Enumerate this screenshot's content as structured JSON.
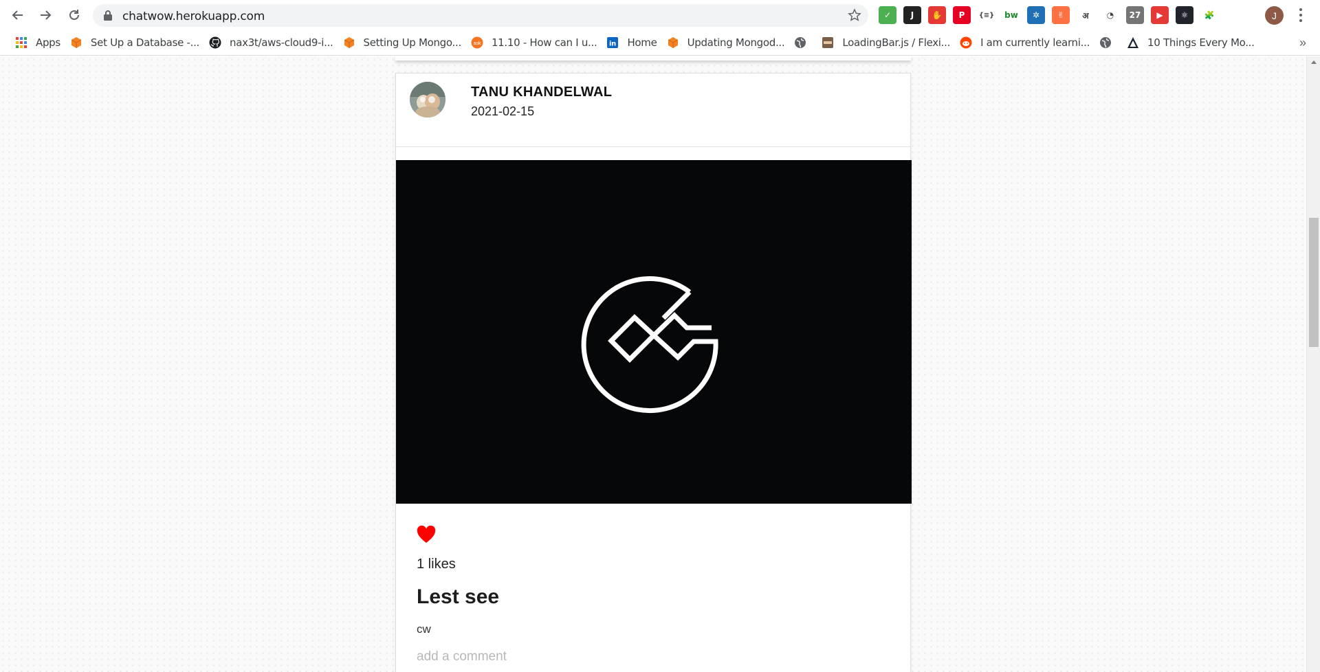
{
  "browser": {
    "url": "chatwow.herokuapp.com",
    "profile_initial": "J",
    "more_bookmarks": "»"
  },
  "bookmarks": [
    {
      "label": "Apps",
      "icon": "apps-grid-icon"
    },
    {
      "label": "Set Up a Database -...",
      "icon": "aws-cube-icon"
    },
    {
      "label": "nax3t/aws-cloud9-i...",
      "icon": "github-icon"
    },
    {
      "label": "Setting Up Mongo...",
      "icon": "aws-cube-icon"
    },
    {
      "label": "11.10 - How can I u...",
      "icon": "askubuntu-icon"
    },
    {
      "label": "Home",
      "icon": "linkedin-icon"
    },
    {
      "label": "Updating Mongod...",
      "icon": "aws-cube-icon"
    },
    {
      "label": "",
      "icon": "globe-icon"
    },
    {
      "label": "LoadingBar.js / Flexi...",
      "icon": "loadingbar-icon"
    },
    {
      "label": "I am currently learni...",
      "icon": "reddit-icon"
    },
    {
      "label": "",
      "icon": "globe-icon"
    },
    {
      "label": "10 Things Every Mo...",
      "icon": "triangle-logo-icon"
    }
  ],
  "extensions": [
    {
      "name": "mail-check-extension",
      "glyph": "✓",
      "color": "#4caf50"
    },
    {
      "name": "terminal-extension",
      "glyph": "J",
      "color": "#222222"
    },
    {
      "name": "adblock-extension",
      "glyph": "✋",
      "color": "#e53935"
    },
    {
      "name": "pinterest-extension",
      "glyph": "P",
      "color": "#e60023"
    },
    {
      "name": "json-extension",
      "glyph": "{≡}",
      "color": "#ffffff"
    },
    {
      "name": "bw-extension",
      "glyph": "bw",
      "color": "#ffffff"
    },
    {
      "name": "blue-wheel-extension",
      "glyph": "✲",
      "color": "#1e6fb3"
    },
    {
      "name": "orange-hand-extension",
      "glyph": "✌",
      "color": "#ff7043"
    },
    {
      "name": "hindi-extension",
      "glyph": "अ",
      "color": "#ffffff"
    },
    {
      "name": "clock-extension",
      "glyph": "◔",
      "color": "#ffffff"
    },
    {
      "name": "calendar-extension",
      "glyph": "27",
      "color": "#757575"
    },
    {
      "name": "youtube-extension",
      "glyph": "▶",
      "color": "#e53935"
    },
    {
      "name": "react-devtools-extension",
      "glyph": "⚛",
      "color": "#20232a"
    },
    {
      "name": "puzzle-extension",
      "glyph": "🧩",
      "color": "#ffffff"
    }
  ],
  "post": {
    "author": "TANU KHANDELWAL",
    "date": "2021-02-15",
    "likes": "1 likes",
    "title": "Lest see",
    "body": "cw",
    "comment_placeholder": "add a comment",
    "liked": true,
    "like_color": "#ff0000",
    "image_bg": "#060708"
  }
}
